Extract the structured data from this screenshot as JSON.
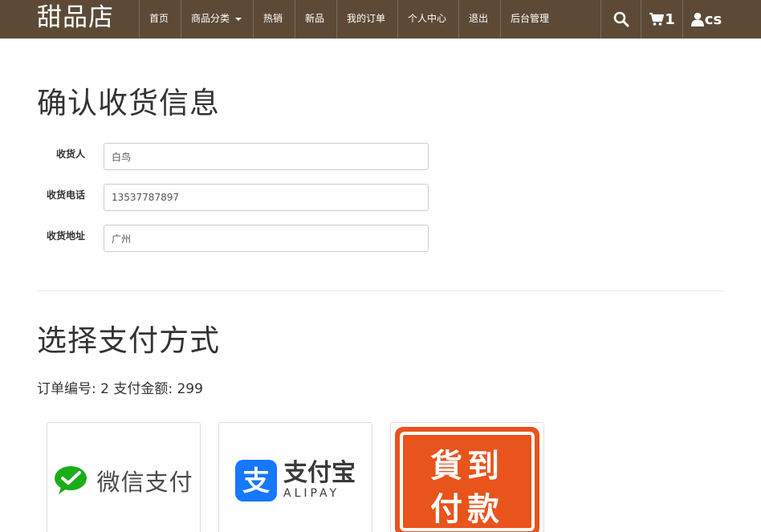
{
  "navbar": {
    "brand": "甜品店",
    "items": [
      {
        "label": "首页"
      },
      {
        "label": "商品分类"
      },
      {
        "label": "热销"
      },
      {
        "label": "新品"
      },
      {
        "label": "我的订单"
      },
      {
        "label": "个人中心"
      },
      {
        "label": "退出"
      },
      {
        "label": "后台管理"
      }
    ],
    "cart_count": "1",
    "username": "cs",
    "icons": {
      "search": "search-icon",
      "cart": "cart-icon",
      "user": "user-icon",
      "dropdown": "caret-down-icon"
    },
    "colors": {
      "background": "#5c4a37",
      "text": "#ffffff"
    }
  },
  "shipping": {
    "title": "确认收货信息",
    "fields": [
      {
        "label": "收货人",
        "value": "白鸟"
      },
      {
        "label": "收货电话",
        "value": "13537787897"
      },
      {
        "label": "收货地址",
        "value": "广州"
      }
    ]
  },
  "payment": {
    "title": "选择支付方式",
    "order_info": "订单编号: 2 支付金额: 299",
    "methods": [
      {
        "name": "微信支付",
        "icon": "wechat-pay-logo",
        "color": "#1aad19"
      },
      {
        "name": "支付宝",
        "subtitle": "ALIPAY",
        "icon": "alipay-logo",
        "color": "#1677ff"
      },
      {
        "name_line1": "貨到",
        "name_line2": "付款",
        "icon": "cash-on-delivery-logo",
        "color": "#e9531c"
      }
    ]
  }
}
